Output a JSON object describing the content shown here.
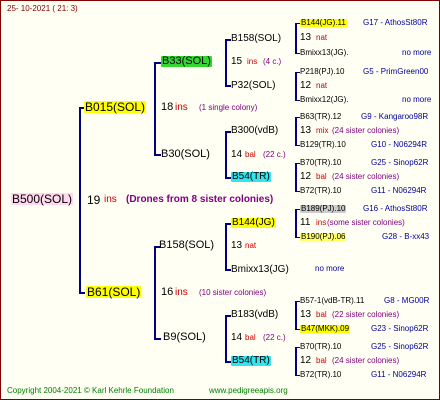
{
  "header": {
    "date": "25- 10-2021 ( 21: 3)"
  },
  "footer": {
    "copyright": "Copyright 2004-2021 © Karl Kehrle Foundation",
    "site": "www.pedigreeapis.org"
  },
  "root": {
    "name": "B500(SOL)",
    "num": "19",
    "ins": "ins",
    "note": "(Drones from 8 sister colonies)"
  },
  "p1": {
    "name": "B015(SOL)",
    "num": "18",
    "ins": "ins",
    "note": "(1 single colony)"
  },
  "p2": {
    "name": "B61(SOL)",
    "num": "16",
    "ins": "ins",
    "note": "(10 sister colonies)"
  },
  "gp": [
    {
      "name": "B33(SOL)",
      "num": "15",
      "ins": "ins",
      "note": "(4 c.)"
    },
    {
      "name": "B30(SOL)",
      "num": "14",
      "ins": "bal",
      "note": "(22 c.)"
    },
    {
      "name": "B158(SOL)",
      "num": "13",
      "ins": "nat",
      "note": ""
    },
    {
      "name": "B9(SOL)",
      "num": "14",
      "ins": "bal",
      "note": "(22 c.)"
    }
  ],
  "g3": [
    {
      "name": "B158(SOL)",
      "num": "13",
      "ins": "nat"
    },
    {
      "name": "P32(SOL)",
      "num": "12",
      "ins": "nat"
    },
    {
      "name": "B300(vdB)",
      "num": "14",
      "ins": "bal",
      "note": "(22 c.)"
    },
    {
      "name": "B54(TR)",
      "num": "",
      "ins": ""
    },
    {
      "name": "B144(JG)",
      "num": "13",
      "ins": "nat"
    },
    {
      "name": "Bmixx13(JG)",
      "num": "",
      "ins": ""
    },
    {
      "name": "B183(vdB)",
      "num": "14",
      "ins": "bal",
      "note": "(22 c.)"
    },
    {
      "name": "B54(TR)",
      "num": "",
      "ins": ""
    }
  ],
  "g4": [
    {
      "name": "B144(JG).11",
      "info": "G17 - AthosSt80R"
    },
    {
      "num": "13",
      "ins": "nat"
    },
    {
      "name": "Bmixx13(JG).",
      "info": "no more"
    },
    {
      "name": "P218(PJ).10",
      "info": "G5 - PrimGreen00"
    },
    {
      "num": "12",
      "ins": "nat"
    },
    {
      "name": "Bmixx12(JG).",
      "info": "no more"
    },
    {
      "name": "B63(TR).12",
      "info": "G9 - Kangaroo98R"
    },
    {
      "num": "13",
      "ins": "mix",
      "note": "(24 sister colonies)"
    },
    {
      "name": "B129(TR).10",
      "info": "G10 - N06294R"
    },
    {
      "name": "B70(TR).10",
      "info": "G25 - Sinop62R"
    },
    {
      "num": "12",
      "ins": "bal",
      "note": "(24 sister colonies)"
    },
    {
      "name": "B72(TR).10",
      "info": "G11 - N06294R"
    },
    {
      "name": "B189(PJ).10",
      "info": "G16 - AthosSt80R"
    },
    {
      "num": "11",
      "ins": "ins",
      "note": "(some sister colonies)"
    },
    {
      "name": "B190(PJ).06",
      "info": "G28 - B-xx43"
    },
    {
      "info": "no more"
    },
    {
      "name": "B57-1(vdB-TR).11",
      "info": "G8 - MG00R"
    },
    {
      "num": "13",
      "ins": "bal",
      "note": "(22 sister colonies)"
    },
    {
      "name": "B47(MKK).09",
      "info": "G23 - Sinop62R"
    },
    {
      "name": "B70(TR).10",
      "info": "G25 - Sinop62R"
    },
    {
      "num": "12",
      "ins": "bal",
      "note": "(24 sister colonies)"
    },
    {
      "name": "B72(TR).10",
      "info": "G11 - N06294R"
    }
  ]
}
